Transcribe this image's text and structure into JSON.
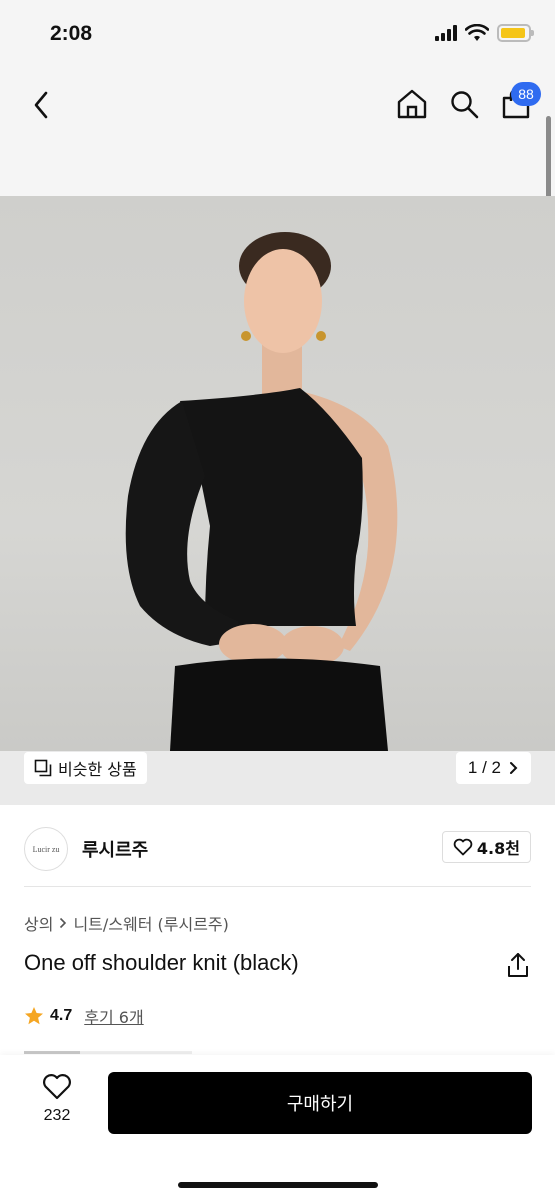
{
  "status_bar": {
    "time": "2:08"
  },
  "nav": {
    "cart_badge": "88"
  },
  "image_strip": {
    "similar_label": "비슷한 상품",
    "pager_label": "1 / 2"
  },
  "brand": {
    "logo_text": "Lucir zu",
    "name": "루시르주",
    "likes": "4.8천"
  },
  "breadcrumb": {
    "category": "상의",
    "subcategory": "니트/스웨터 (루시르주)"
  },
  "product": {
    "title": "One off shoulder knit (black)",
    "rating": "4.7",
    "reviews": "후기 6개"
  },
  "bottom_bar": {
    "wish_count": "232",
    "buy_label": "구매하기"
  },
  "colors": {
    "accent_badge": "#2f6bf0",
    "star": "#f5a623",
    "buy_button": "#000000"
  }
}
